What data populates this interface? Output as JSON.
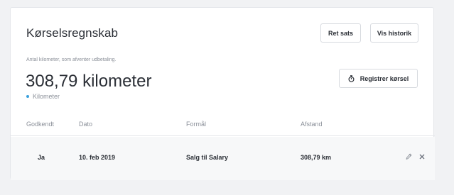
{
  "header": {
    "title": "Kørselsregnskab",
    "ret_sats_label": "Ret sats",
    "vis_historik_label": "Vis historik"
  },
  "summary": {
    "subtitle": "Antal kilometer, som afventer udbetaling.",
    "value": "308,79 kilometer",
    "legend_label": "Kilometer",
    "legend_color": "#3aa0dd",
    "register_label": "Registrer kørsel",
    "register_icon": "stopwatch-icon"
  },
  "table": {
    "columns": [
      "Godkendt",
      "Dato",
      "Formål",
      "Afstand"
    ],
    "rows": [
      {
        "godkendt": "Ja",
        "dato": "10. feb 2019",
        "formaal": "Salg til Salary",
        "afstand": "308,79 km",
        "actions": [
          "pencil-icon",
          "close-icon"
        ]
      }
    ]
  }
}
